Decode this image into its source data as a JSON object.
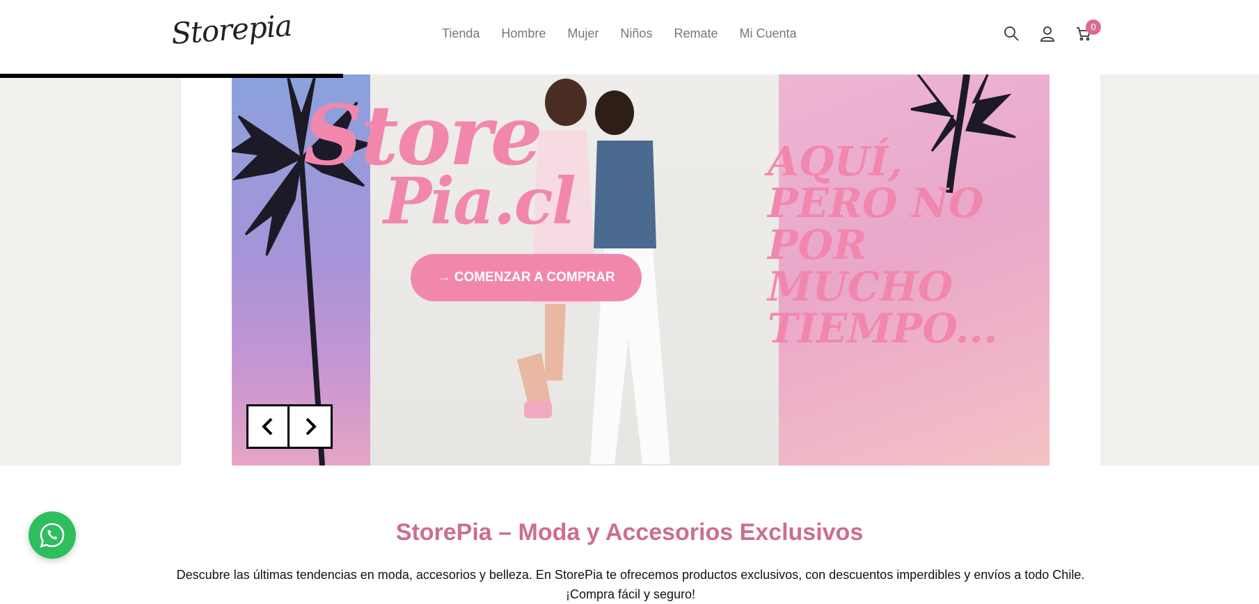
{
  "header": {
    "logo_text": "Storepia",
    "nav": [
      "Tienda",
      "Hombre",
      "Mujer",
      "Niños",
      "Remate",
      "Mi Cuenta"
    ],
    "cart_count": "0"
  },
  "hero": {
    "brand_line1": "Store",
    "brand_line2": "Pia.cl",
    "cta_label": "→ COMENZAR A COMPRAR",
    "tagline": "AQUÍ, PERO NO POR MUCHO TIEMPO..."
  },
  "section": {
    "title": "StorePia – Moda y Accesorios Exclusivos",
    "description": "Descubre las últimas tendencias en moda, accesorios y belleza. En StorePia te ofrecemos productos exclusivos, con descuentos imperdibles y envíos a todo Chile. ¡Compra fácil y seguro!"
  },
  "colors": {
    "accent_pink": "#f287ae",
    "title_pink": "#cc6e8f",
    "whatsapp_green": "#2fbe5d"
  },
  "icons": {
    "search": "search-icon",
    "account": "user-icon",
    "cart": "cart-icon",
    "prev": "chevron-left-icon",
    "next": "chevron-right-icon",
    "whatsapp": "whatsapp-icon"
  }
}
